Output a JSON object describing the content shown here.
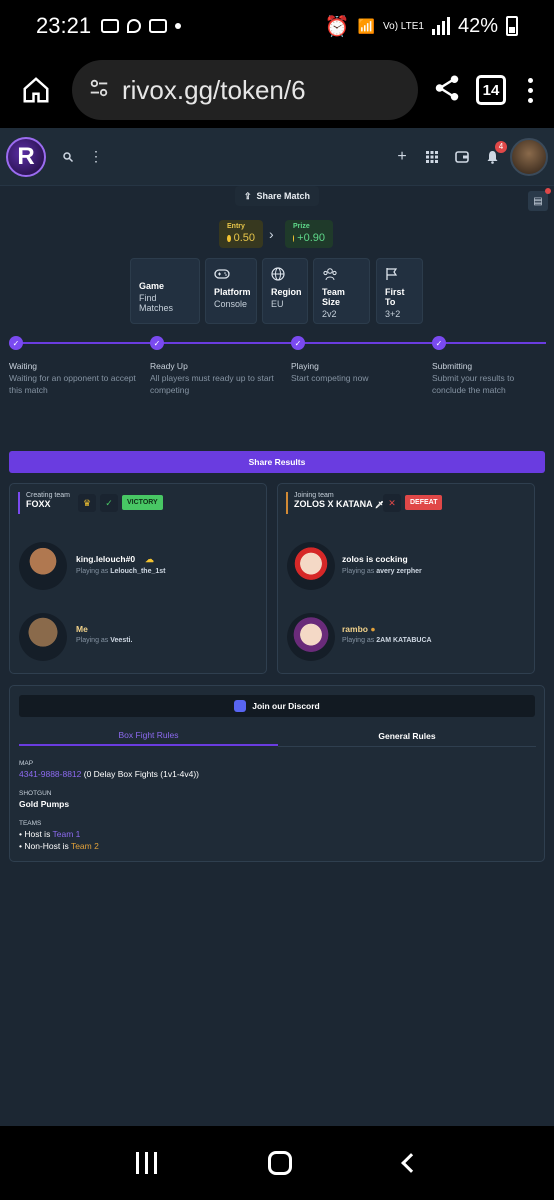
{
  "status": {
    "time": "23:21",
    "battery": "42%",
    "network": "Vo) LTE1"
  },
  "browser": {
    "url": "rivox.gg/token/6",
    "tab_count": "14"
  },
  "site": {
    "logo_letter": "R",
    "notif_count": "4"
  },
  "match": {
    "share_match_label": "Share Match",
    "entry_label": "Entry",
    "entry_value": "0.50",
    "prize_label": "Prize",
    "prize_value": "+0.90",
    "info": [
      {
        "title": "Game",
        "value": "Find Matches"
      },
      {
        "title": "Platform",
        "value": "Console"
      },
      {
        "title": "Region",
        "value": "EU"
      },
      {
        "title": "Team Size",
        "value": "2v2"
      },
      {
        "title": "First To",
        "value": "3+2"
      }
    ],
    "steps": [
      {
        "title": "Waiting",
        "desc": "Waiting for an opponent to accept this match"
      },
      {
        "title": "Ready Up",
        "desc": "All players must ready up to start competing"
      },
      {
        "title": "Playing",
        "desc": "Start competing now"
      },
      {
        "title": "Submitting",
        "desc": "Submit your results to conclude the match"
      }
    ],
    "share_results_label": "Share Results"
  },
  "teams": [
    {
      "role": "Creating team",
      "name": "FOXX",
      "result": "VICTORY",
      "players": [
        {
          "name": "king.lelouch#0",
          "playing_as_label": "Playing as",
          "playing_as": "Lelouch_the_1st"
        },
        {
          "name": "Me",
          "playing_as_label": "Playing as",
          "playing_as": "Veesti."
        }
      ]
    },
    {
      "role": "Joining team",
      "name": "ZOLOS X KATANA",
      "result": "DEFEAT",
      "players": [
        {
          "name": "zolos is cocking",
          "playing_as_label": "Playing as",
          "playing_as": "avery zerpher"
        },
        {
          "name": "rambo",
          "playing_as_label": "Playing as",
          "playing_as": "2AM KATABUCA"
        }
      ]
    }
  ],
  "rules": {
    "discord_label": "Join our Discord",
    "tabs": [
      "Box Fight Rules",
      "General Rules"
    ],
    "map_label": "MAP",
    "map_code": "4341-9888-8812",
    "map_desc": " (0 Delay Box Fights (1v1-4v4))",
    "shotgun_label": "SHOTGUN",
    "shotgun_value": "Gold Pumps",
    "teams_label": "TEAMS",
    "host_prefix": "Host is ",
    "host_team": "Team 1",
    "nonhost_prefix": "Non-Host is ",
    "nonhost_team": "Team 2"
  },
  "colors": {
    "accent": "#6a3ce0",
    "victory": "#48c764",
    "defeat": "#e04848",
    "bg": "#1c2733"
  }
}
